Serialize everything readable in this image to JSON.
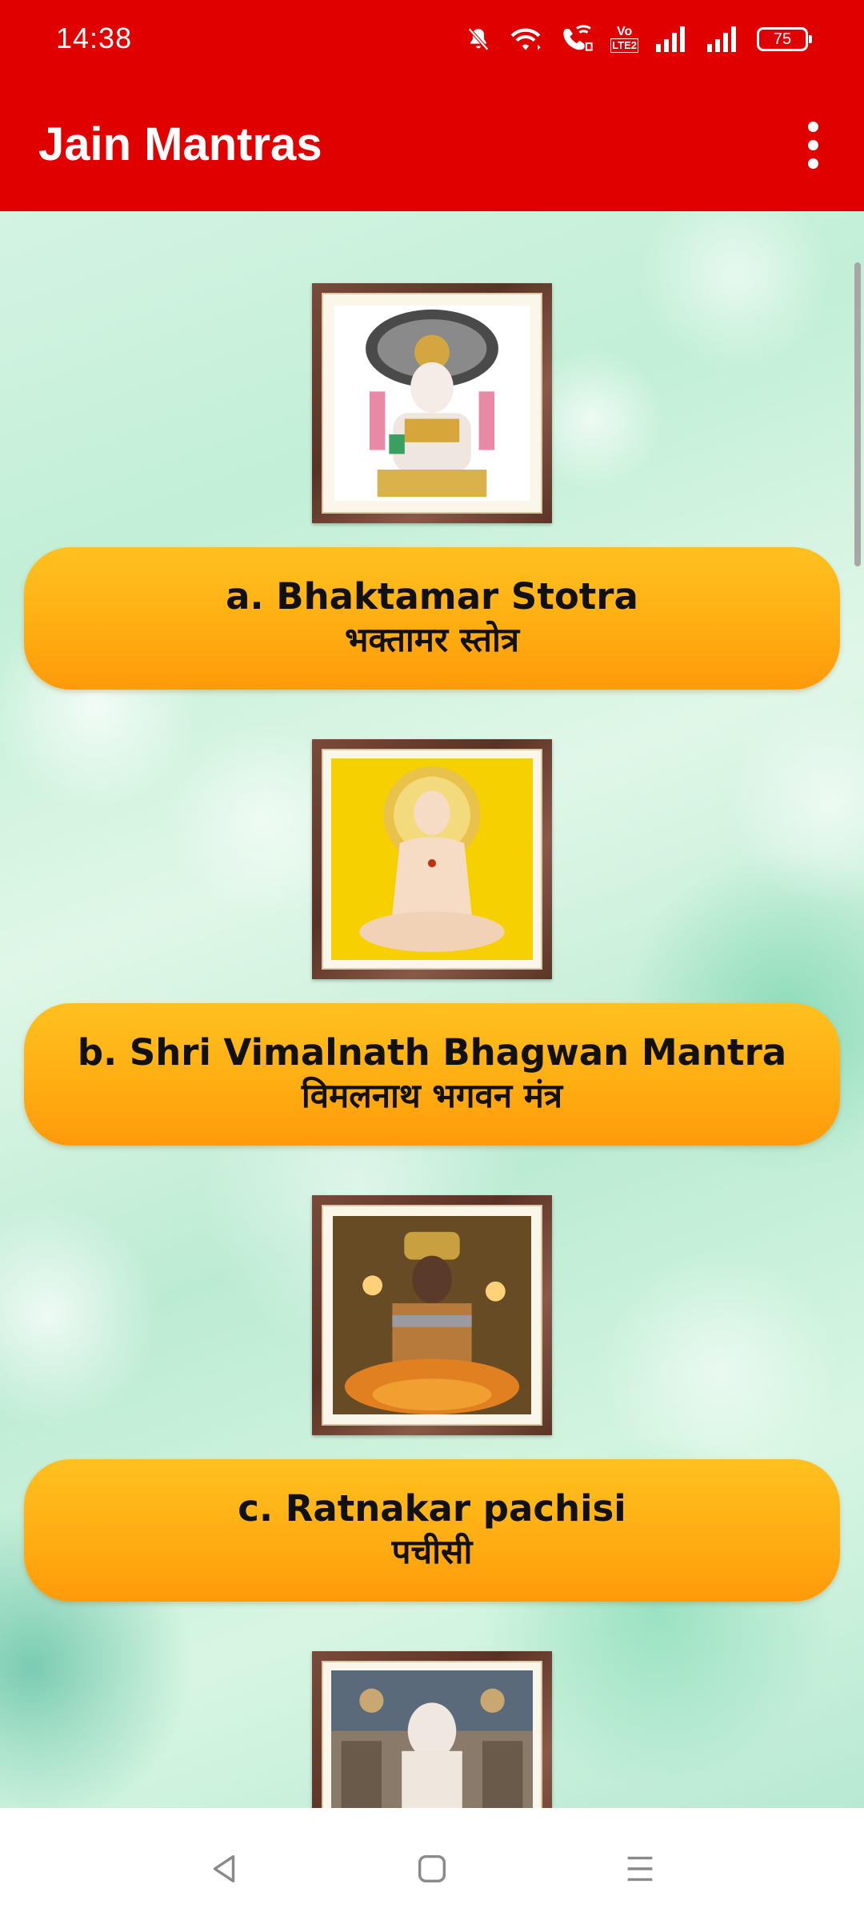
{
  "status_bar": {
    "time": "14:38",
    "battery_level": "75",
    "icons": [
      "mute-icon",
      "wifi-icon",
      "wifi-calling-icon",
      "volte-icon",
      "signal-icon",
      "signal-icon",
      "battery-icon"
    ],
    "volte_text_top": "Vo",
    "volte_text_bottom": "LTE2"
  },
  "app_bar": {
    "title": "Jain Mantras",
    "menu_icon": "more-vert-icon",
    "background": "#e00000"
  },
  "mantras": [
    {
      "title": "a. Bhaktamar Stotra",
      "subtitle": "भक्तामर स्तोत्र",
      "image": "parshvanath-idol-image"
    },
    {
      "title": "b. Shri Vimalnath Bhagwan Mantra",
      "subtitle": "विमलनाथ भगवन मंत्र",
      "image": "vimalnath-image"
    },
    {
      "title": "c. Ratnakar pachisi",
      "subtitle": "पचीसी",
      "image": "ratnakar-idol-image"
    },
    {
      "title": "",
      "subtitle": "",
      "image": "temple-idol-image"
    }
  ],
  "colors": {
    "accent": "#e00000",
    "button": "#ffae12"
  },
  "nav_bar": {
    "icons": [
      "back-icon",
      "home-icon",
      "recents-icon"
    ]
  }
}
